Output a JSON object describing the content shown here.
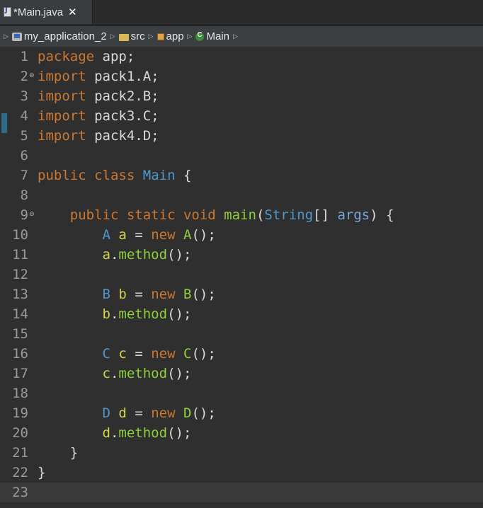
{
  "tab": {
    "title": "*Main.java",
    "close_glyph": "✕",
    "icon": "java-file-icon"
  },
  "breadcrumb": [
    {
      "label": "my_application_2",
      "icon": "project-icon"
    },
    {
      "label": "src",
      "icon": "folder-icon"
    },
    {
      "label": "app",
      "icon": "package-icon"
    },
    {
      "label": "Main",
      "icon": "class-icon"
    }
  ],
  "colors": {
    "keyword": "#cc7832",
    "type": "#4f98ca",
    "variable": "#d7d44a",
    "method": "#8fcf3a",
    "background": "#2f2f2f"
  },
  "editor": {
    "current_line": 23,
    "lines": [
      {
        "n": "1",
        "tokens": [
          [
            "kw",
            "package"
          ],
          [
            "plain",
            " app;"
          ]
        ]
      },
      {
        "n": "2",
        "fold": true,
        "tokens": [
          [
            "kw",
            "import"
          ],
          [
            "plain",
            " pack1.A;"
          ]
        ]
      },
      {
        "n": "3",
        "tokens": [
          [
            "kw",
            "import"
          ],
          [
            "plain",
            " pack2.B;"
          ]
        ]
      },
      {
        "n": "4",
        "tokens": [
          [
            "kw",
            "import"
          ],
          [
            "plain",
            " pack3.C;"
          ]
        ]
      },
      {
        "n": "5",
        "tokens": [
          [
            "kw",
            "import"
          ],
          [
            "plain",
            " pack4.D;"
          ]
        ]
      },
      {
        "n": "6",
        "tokens": []
      },
      {
        "n": "7",
        "tokens": [
          [
            "kw",
            "public"
          ],
          [
            "plain",
            " "
          ],
          [
            "kw",
            "class"
          ],
          [
            "plain",
            " "
          ],
          [
            "type",
            "Main"
          ],
          [
            "plain",
            " {"
          ]
        ]
      },
      {
        "n": "8",
        "tokens": []
      },
      {
        "n": "9",
        "fold": true,
        "tokens": [
          [
            "plain",
            "    "
          ],
          [
            "kw",
            "public"
          ],
          [
            "plain",
            " "
          ],
          [
            "kw",
            "static"
          ],
          [
            "plain",
            " "
          ],
          [
            "kw",
            "void"
          ],
          [
            "plain",
            " "
          ],
          [
            "meth",
            "main"
          ],
          [
            "plain",
            "("
          ],
          [
            "type",
            "String"
          ],
          [
            "plain",
            "[] "
          ],
          [
            "param",
            "args"
          ],
          [
            "plain",
            ") {"
          ]
        ]
      },
      {
        "n": "10",
        "tokens": [
          [
            "plain",
            "        "
          ],
          [
            "type",
            "A"
          ],
          [
            "plain",
            " "
          ],
          [
            "var",
            "a"
          ],
          [
            "plain",
            " = "
          ],
          [
            "kw",
            "new"
          ],
          [
            "plain",
            " "
          ],
          [
            "meth",
            "A"
          ],
          [
            "plain",
            "();"
          ]
        ]
      },
      {
        "n": "11",
        "tokens": [
          [
            "plain",
            "        "
          ],
          [
            "var",
            "a"
          ],
          [
            "plain",
            "."
          ],
          [
            "meth",
            "method"
          ],
          [
            "plain",
            "();"
          ]
        ]
      },
      {
        "n": "12",
        "tokens": []
      },
      {
        "n": "13",
        "tokens": [
          [
            "plain",
            "        "
          ],
          [
            "type",
            "B"
          ],
          [
            "plain",
            " "
          ],
          [
            "var",
            "b"
          ],
          [
            "plain",
            " = "
          ],
          [
            "kw",
            "new"
          ],
          [
            "plain",
            " "
          ],
          [
            "meth",
            "B"
          ],
          [
            "plain",
            "();"
          ]
        ]
      },
      {
        "n": "14",
        "tokens": [
          [
            "plain",
            "        "
          ],
          [
            "var",
            "b"
          ],
          [
            "plain",
            "."
          ],
          [
            "meth",
            "method"
          ],
          [
            "plain",
            "();"
          ]
        ]
      },
      {
        "n": "15",
        "tokens": []
      },
      {
        "n": "16",
        "tokens": [
          [
            "plain",
            "        "
          ],
          [
            "type",
            "C"
          ],
          [
            "plain",
            " "
          ],
          [
            "var",
            "c"
          ],
          [
            "plain",
            " = "
          ],
          [
            "kw",
            "new"
          ],
          [
            "plain",
            " "
          ],
          [
            "meth",
            "C"
          ],
          [
            "plain",
            "();"
          ]
        ]
      },
      {
        "n": "17",
        "tokens": [
          [
            "plain",
            "        "
          ],
          [
            "var",
            "c"
          ],
          [
            "plain",
            "."
          ],
          [
            "meth",
            "method"
          ],
          [
            "plain",
            "();"
          ]
        ]
      },
      {
        "n": "18",
        "tokens": []
      },
      {
        "n": "19",
        "tokens": [
          [
            "plain",
            "        "
          ],
          [
            "type",
            "D"
          ],
          [
            "plain",
            " "
          ],
          [
            "var",
            "d"
          ],
          [
            "plain",
            " = "
          ],
          [
            "kw",
            "new"
          ],
          [
            "plain",
            " "
          ],
          [
            "meth",
            "D"
          ],
          [
            "plain",
            "();"
          ]
        ]
      },
      {
        "n": "20",
        "tokens": [
          [
            "plain",
            "        "
          ],
          [
            "var",
            "d"
          ],
          [
            "plain",
            "."
          ],
          [
            "meth",
            "method"
          ],
          [
            "plain",
            "();"
          ]
        ]
      },
      {
        "n": "21",
        "tokens": [
          [
            "plain",
            "    }"
          ]
        ]
      },
      {
        "n": "22",
        "tokens": [
          [
            "plain",
            "}"
          ]
        ]
      },
      {
        "n": "23",
        "tokens": []
      }
    ]
  }
}
